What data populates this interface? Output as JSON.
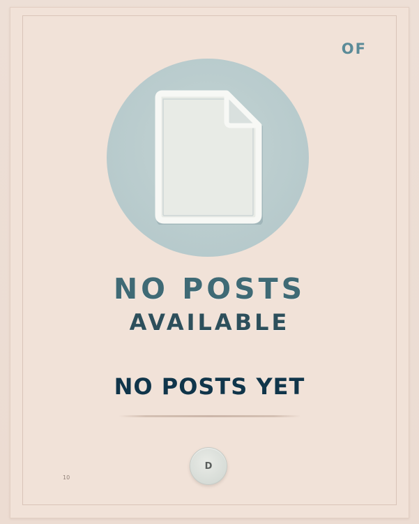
{
  "header": {
    "corner_label": "OF"
  },
  "empty_state": {
    "icon": "document-icon",
    "title_line1": "NO POSTS",
    "title_line2": "AVAILABLE",
    "subtitle": "NO POSTS YET",
    "caption": "",
    "button_label": "D"
  },
  "footer": {
    "note": "10"
  },
  "colors": {
    "background": "#f1e2d8",
    "circle": "#b7cacc",
    "title": "#3f6a75",
    "subtitle": "#10354a",
    "accent": "#5b8b98"
  }
}
